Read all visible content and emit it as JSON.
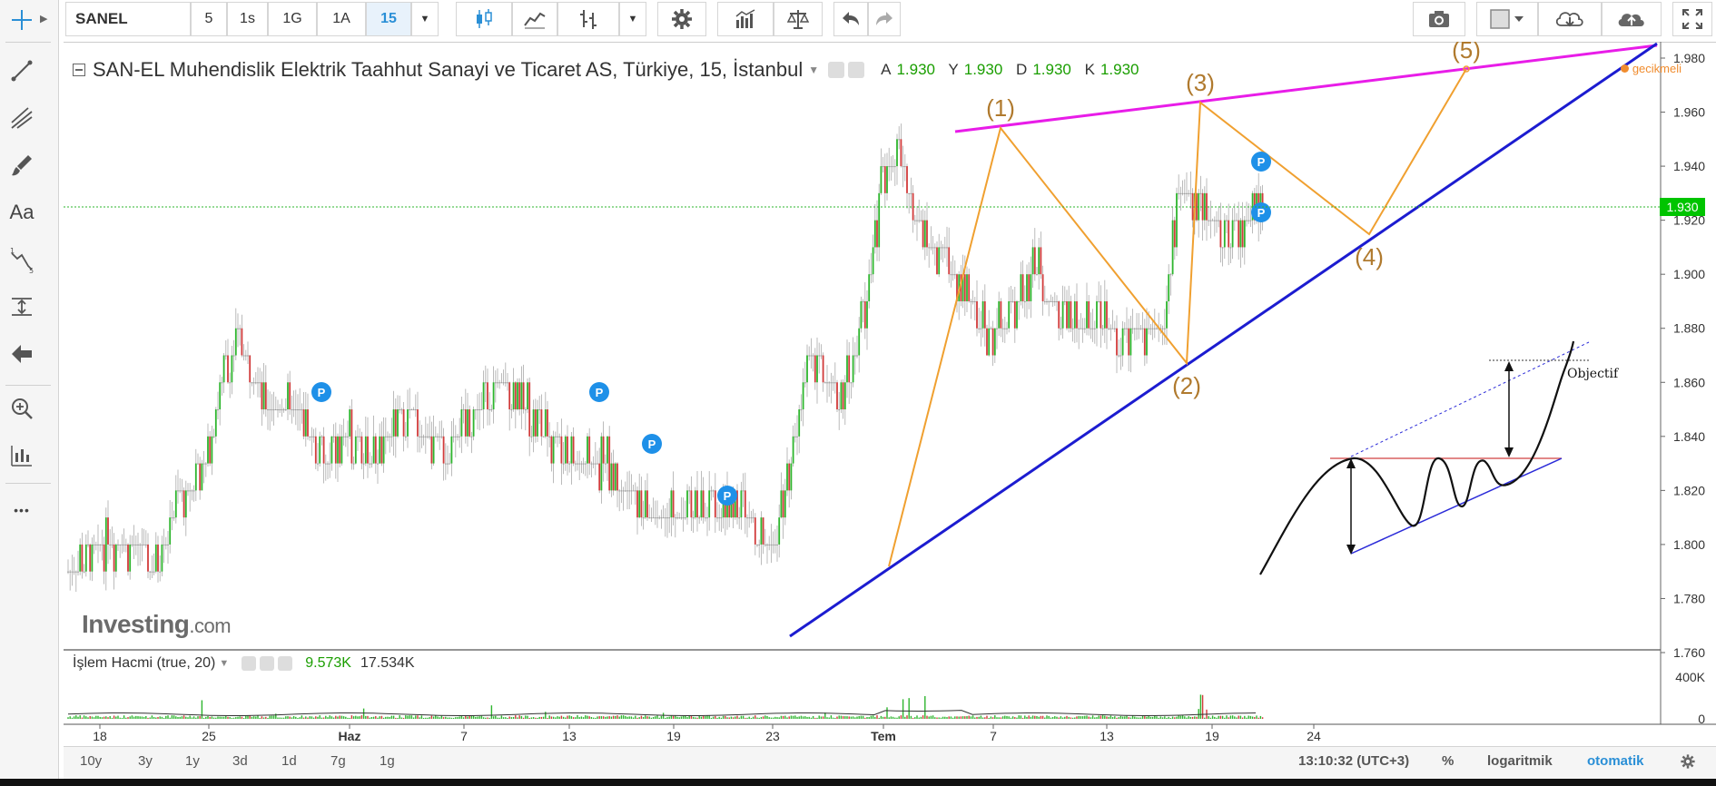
{
  "toolbar": {
    "symbol": "SANEL",
    "intervals": [
      "5",
      "1s",
      "1G",
      "1A",
      "15"
    ],
    "active_interval": "15"
  },
  "left_tools": [
    "crosshair-icon",
    "trendline-icon",
    "pitchfork-icon",
    "brush-icon",
    "text-icon",
    "wave-pattern-icon",
    "measure-icon",
    "back-arrow-icon",
    "zoom-icon",
    "layout-icon",
    "more-icon"
  ],
  "left_tools_text": {
    "text_tool": "Aa",
    "more": "•••"
  },
  "legend": {
    "title": "SAN-EL Muhendislik Elektrik Taahhut Sanayi ve Ticaret AS, Türkiye, 15, İstanbul",
    "ohlc": [
      {
        "k": "A",
        "v": "1.930"
      },
      {
        "k": "Y",
        "v": "1.930"
      },
      {
        "k": "D",
        "v": "1.930"
      },
      {
        "k": "K",
        "v": "1.930"
      }
    ]
  },
  "delay_label": "gecikmeli",
  "watermark": {
    "brand": "Investing",
    "suffix": ".com"
  },
  "volume": {
    "label": "İşlem Hacmi (true, 20)",
    "value1": "9.573K",
    "value2": "17.534K",
    "ticks": [
      "400K",
      "0"
    ]
  },
  "current_price": "1.930",
  "bottom_bar": {
    "ranges": [
      "10y",
      "3y",
      "1y",
      "3d",
      "1d",
      "7g",
      "1g"
    ],
    "time": "13:10:32 (UTC+3)",
    "percent": "%",
    "log": "logaritmik",
    "auto": "otomatik"
  },
  "colors": {
    "up": "#2db52d",
    "down": "#d13b3b",
    "resistance": "#e81ce8",
    "support": "#1c1cd0",
    "wave": "#f0a030",
    "price_label": "#00c400"
  },
  "chart_data": {
    "type": "candlestick",
    "y_ticks": [
      "1.980",
      "1.960",
      "1.940",
      "1.920",
      "1.900",
      "1.880",
      "1.860",
      "1.840",
      "1.820",
      "1.800",
      "1.780",
      "1.760"
    ],
    "ylim": [
      1.76,
      1.98
    ],
    "x_ticks": [
      "18",
      "25",
      "Haz",
      "7",
      "13",
      "19",
      "23",
      "Tem",
      "7",
      "13",
      "19",
      "24"
    ],
    "price_path": [
      [
        0,
        1.79
      ],
      [
        4,
        1.8
      ],
      [
        8,
        1.8
      ],
      [
        10,
        1.79
      ],
      [
        12,
        1.81
      ],
      [
        16,
        1.83
      ],
      [
        18,
        1.86
      ],
      [
        20,
        1.875
      ],
      [
        22,
        1.86
      ],
      [
        24,
        1.85
      ],
      [
        27,
        1.85
      ],
      [
        30,
        1.83
      ],
      [
        33,
        1.84
      ],
      [
        36,
        1.835
      ],
      [
        40,
        1.845
      ],
      [
        44,
        1.835
      ],
      [
        48,
        1.85
      ],
      [
        50,
        1.86
      ],
      [
        53,
        1.855
      ],
      [
        56,
        1.84
      ],
      [
        60,
        1.83
      ],
      [
        63,
        1.83
      ],
      [
        66,
        1.815
      ],
      [
        70,
        1.81
      ],
      [
        74,
        1.815
      ],
      [
        78,
        1.815
      ],
      [
        82,
        1.8
      ],
      [
        84,
        1.82
      ],
      [
        86,
        1.86
      ],
      [
        88,
        1.87
      ],
      [
        90,
        1.85
      ],
      [
        92,
        1.87
      ],
      [
        94,
        1.9
      ],
      [
        95,
        1.93
      ],
      [
        97,
        1.95
      ],
      [
        99,
        1.92
      ],
      [
        101,
        1.91
      ],
      [
        104,
        1.9
      ],
      [
        106,
        1.885
      ],
      [
        108,
        1.875
      ],
      [
        111,
        1.89
      ],
      [
        113,
        1.905
      ],
      [
        115,
        1.89
      ],
      [
        118,
        1.88
      ],
      [
        120,
        1.885
      ],
      [
        123,
        1.875
      ],
      [
        126,
        1.88
      ],
      [
        128,
        1.88
      ],
      [
        130,
        1.93
      ],
      [
        132,
        1.93
      ],
      [
        134,
        1.92
      ],
      [
        136,
        1.915
      ],
      [
        138,
        1.92
      ],
      [
        140,
        1.93
      ]
    ],
    "signal_markers": [
      "P",
      "P",
      "P",
      "P",
      "P",
      "P"
    ],
    "elliott_waves": [
      "(1)",
      "(2)",
      "(3)",
      "(4)",
      "(5)"
    ],
    "pattern_annotation": "Objectif"
  }
}
